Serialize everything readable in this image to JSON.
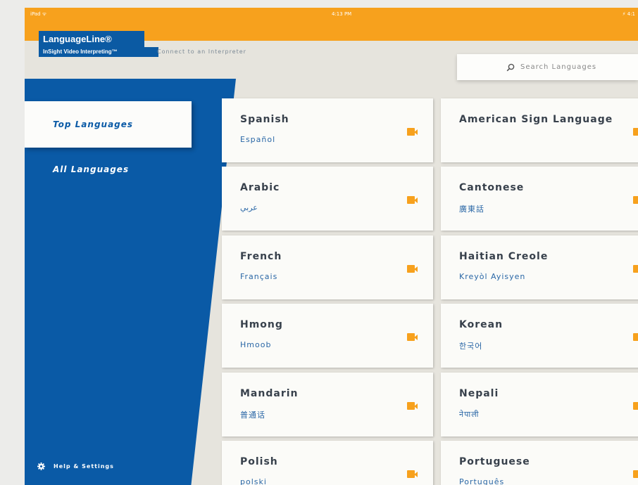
{
  "status_bar": {
    "carrier": "iPad ᯤ",
    "time": "4:13 PM",
    "battery": "⚡ 4:1"
  },
  "logo": {
    "brand": "LanguageLine®",
    "product": "InSight Video Interpreting™"
  },
  "header": {
    "tagline": "Connect to an Interpreter"
  },
  "search": {
    "placeholder": "Search Languages"
  },
  "sidebar": {
    "active_item": "Top Languages",
    "other_item": "All Languages",
    "help": "Help & Settings"
  },
  "languages": [
    {
      "name": "Spanish",
      "native": "Español"
    },
    {
      "name": "American Sign Language",
      "native": ""
    },
    {
      "name": "Arabic",
      "native": "عربي"
    },
    {
      "name": "Cantonese",
      "native": "廣東話"
    },
    {
      "name": "French",
      "native": "Français"
    },
    {
      "name": "Haitian Creole",
      "native": "Kreyòl Ayisyen"
    },
    {
      "name": "Hmong",
      "native": "Hmoob"
    },
    {
      "name": "Korean",
      "native": "한국어"
    },
    {
      "name": "Mandarin",
      "native": "普通话"
    },
    {
      "name": "Nepali",
      "native": "नेपाली"
    },
    {
      "name": "Polish",
      "native": "polski"
    },
    {
      "name": "Portuguese",
      "native": "Português"
    }
  ],
  "colors": {
    "accent": "#f7a11d",
    "brand_blue": "#0a5aa6",
    "text_dark": "#38414c",
    "text_native": "#2a67a6"
  },
  "icons": {
    "search": "search-icon",
    "video": "video-camera-icon",
    "settings": "gear-icon"
  }
}
